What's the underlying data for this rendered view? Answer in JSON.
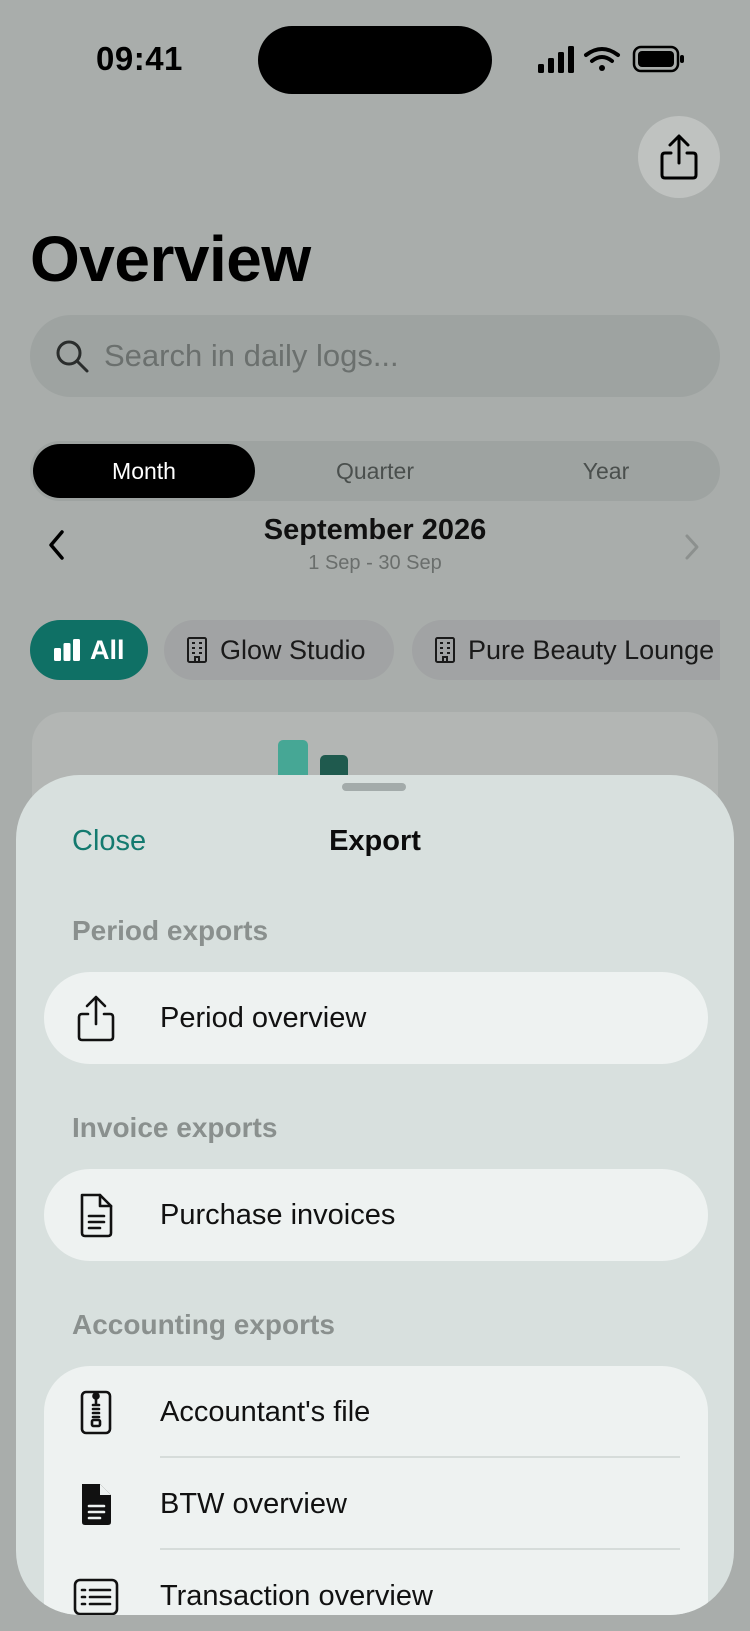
{
  "status_bar": {
    "time": "09:41"
  },
  "header": {
    "title": "Overview",
    "share_icon": "share-icon"
  },
  "search": {
    "placeholder": "Search in daily logs..."
  },
  "segments": [
    {
      "label": "Month",
      "active": true
    },
    {
      "label": "Quarter",
      "active": false
    },
    {
      "label": "Year",
      "active": false
    }
  ],
  "period": {
    "label": "September 2026",
    "range": "1 Sep - 30 Sep"
  },
  "filters": [
    {
      "label": "All",
      "icon": "bar-chart-icon",
      "active": true
    },
    {
      "label": "Glow Studio",
      "icon": "building-icon",
      "active": false
    },
    {
      "label": "Pure Beauty Lounge",
      "icon": "building-icon",
      "active": false
    }
  ],
  "colors": {
    "accent": "#0f7065",
    "link": "#137a6f",
    "bar_light": "#46a795",
    "bar_dark": "#1f5a4e"
  },
  "sheet": {
    "close_label": "Close",
    "title": "Export",
    "sections": [
      {
        "heading": "Period exports",
        "items": [
          {
            "label": "Period overview",
            "icon": "share-icon"
          }
        ]
      },
      {
        "heading": "Invoice exports",
        "items": [
          {
            "label": "Purchase invoices",
            "icon": "document-icon"
          }
        ]
      },
      {
        "heading": "Accounting exports",
        "items": [
          {
            "label": "Accountant's file",
            "icon": "zip-file-icon"
          },
          {
            "label": "BTW overview",
            "icon": "filled-document-icon"
          },
          {
            "label": "Transaction overview",
            "icon": "list-icon"
          }
        ]
      }
    ]
  }
}
